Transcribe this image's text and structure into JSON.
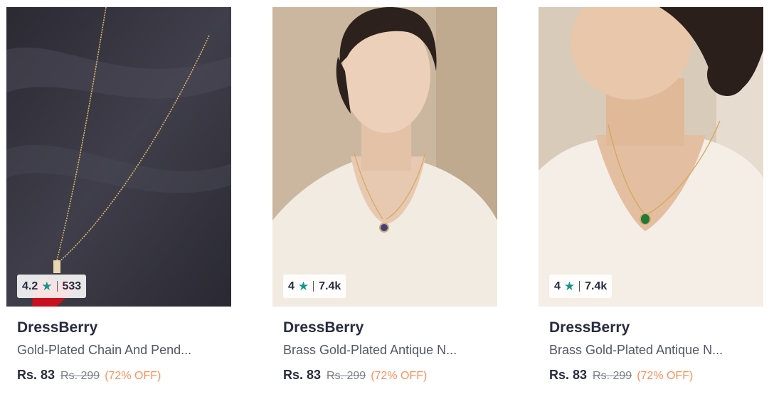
{
  "products": [
    {
      "image": "necklace-on-dark-fabric",
      "rating": "4.2",
      "rating_count": "533",
      "brand": "DressBerry",
      "title": "Gold-Plated Chain And Pend...",
      "price": "Rs. 83",
      "mrp": "Rs. 299",
      "discount": "(72% OFF)"
    },
    {
      "image": "model-wearing-blue-pendant",
      "rating": "4",
      "rating_count": "7.4k",
      "brand": "DressBerry",
      "title": "Brass Gold-Plated Antique N...",
      "price": "Rs. 83",
      "mrp": "Rs. 299",
      "discount": "(72% OFF)"
    },
    {
      "image": "model-wearing-green-pendant",
      "rating": "4",
      "rating_count": "7.4k",
      "brand": "DressBerry",
      "title": "Brass Gold-Plated Antique N...",
      "price": "Rs. 83",
      "mrp": "Rs. 299",
      "discount": "(72% OFF)"
    }
  ],
  "colors": {
    "star": "#14958f",
    "discount": "#ff905a",
    "brand_text": "#282c3f",
    "muted_text": "#535766"
  }
}
